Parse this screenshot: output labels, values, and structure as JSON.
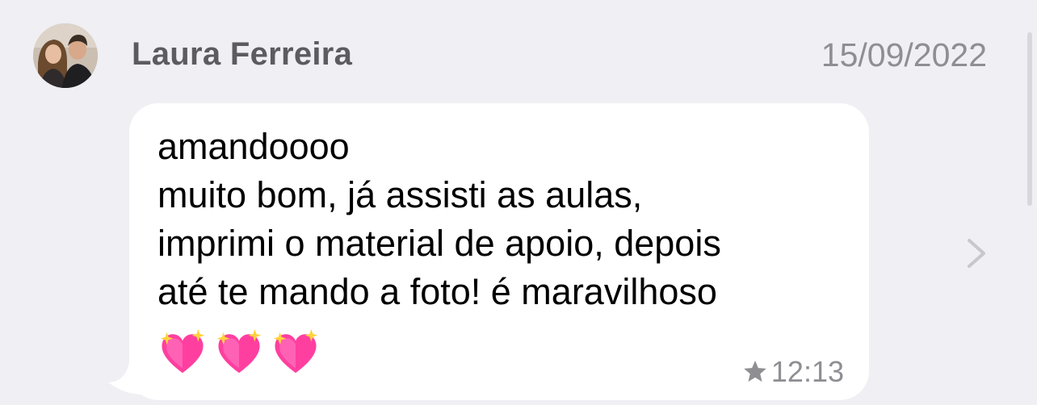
{
  "header": {
    "sender_name": "Laura Ferreira",
    "date": "15/09/2022",
    "avatar_icon": "profile-photo-couple"
  },
  "message": {
    "lines": [
      "amandoooo",
      "muito bom, já assisti as aulas,",
      "imprimi o material de apoio, depois",
      "até te mando a foto! é maravilhoso"
    ],
    "emojis": [
      "sparkling-heart-emoji",
      "sparkling-heart-emoji",
      "sparkling-heart-emoji"
    ],
    "time": "12:13",
    "starred_icon": "star-icon"
  },
  "navigation": {
    "chevron_icon": "chevron-right-icon"
  },
  "colors": {
    "background": "#efeff4",
    "bubble": "#ffffff",
    "secondary_text": "#8e8e93",
    "name_text": "#5c5c60",
    "heart": "#ff2d95",
    "sparkle": "#ffd23c"
  }
}
